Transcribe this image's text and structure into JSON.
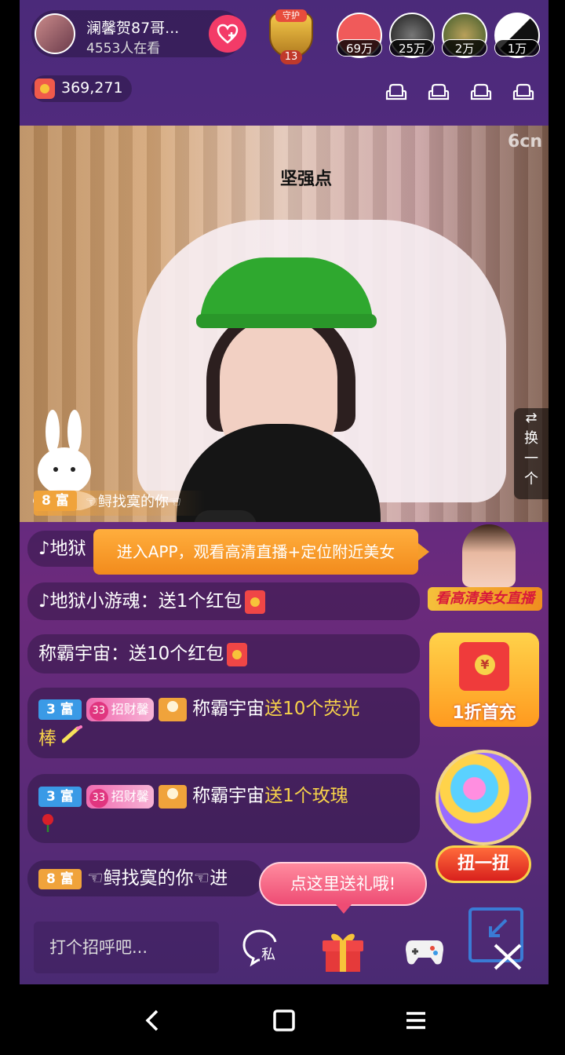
{
  "anchor": {
    "name": "澜馨贺87哥...",
    "viewers": "4553人在看"
  },
  "guard": {
    "top_label": "守护",
    "level": "13"
  },
  "rank_users": [
    {
      "count": "69万",
      "color": "#f05a5a"
    },
    {
      "count": "25万",
      "color": "#3a3a3a"
    },
    {
      "count": "2万",
      "color": "#5a7a3a"
    },
    {
      "count": "1万",
      "color": "#2a2a2a"
    }
  ],
  "coins": {
    "value": "369,271"
  },
  "video": {
    "brand": "6cn",
    "helmet_text": "坚强点",
    "switch_label": [
      "⇄",
      "换",
      "一",
      "个"
    ]
  },
  "entry": {
    "badge": "8 富",
    "text": "☜鲟找寞的你☜"
  },
  "app_banner": "进入APP，观看高清直播+定位附近美女",
  "chat": [
    {
      "user": "♪地狱",
      "text": ""
    },
    {
      "user": "♪地狱小游魂",
      "text": "：送1个红包"
    },
    {
      "user": "称霸宇宙",
      "text": "：送10个红包"
    },
    {
      "badge": "3 富",
      "level": "33",
      "title": "招财馨",
      "user": "称霸宇宙",
      "gift_text": "送10个荧光",
      "gift_text_2": "棒"
    },
    {
      "badge": "3 富",
      "level": "33",
      "title": "招财馨",
      "user": "称霸宇宙",
      "gift_text": "送1个玫瑰"
    },
    {
      "badge": "8 富",
      "user": "☜鲟找寞的你☜进"
    }
  ],
  "promos": {
    "live_label": "看高清美女直播",
    "recharge_symbol": "¥",
    "recharge_label": "1折首充",
    "gacha_label": "扭一扭"
  },
  "gift_tip": "点这里送礼哦!",
  "input": {
    "placeholder": "打个招呼吧..."
  },
  "pm_label": "私",
  "colors": {
    "accent_pink": "#f33b68",
    "gold_text": "#f7d24a",
    "rich_badge_8": "#f0a33b",
    "rich_badge_3": "#3a9ae6"
  }
}
